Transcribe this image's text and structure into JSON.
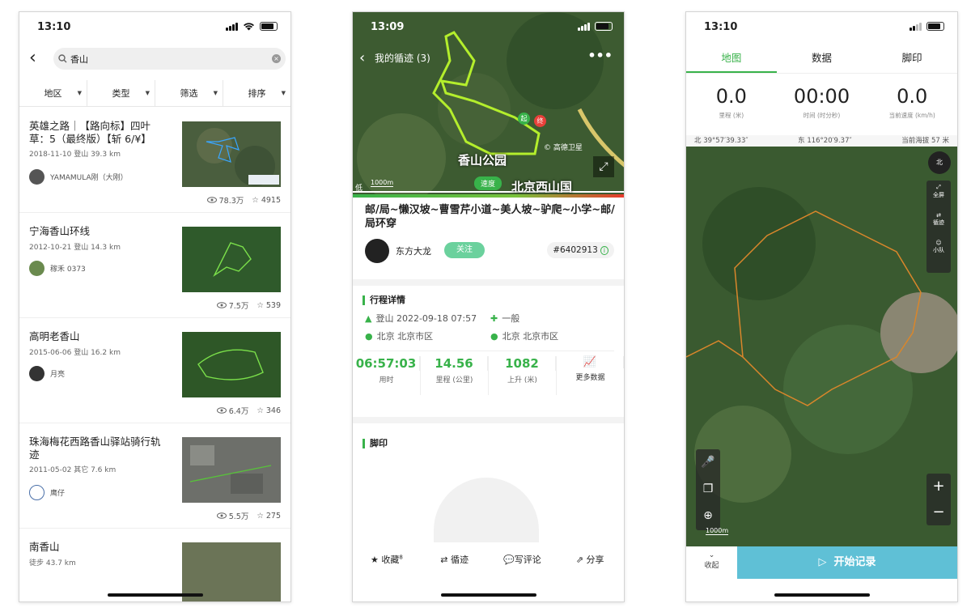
{
  "phone1": {
    "status": {
      "time": "13:10"
    },
    "search": {
      "query": "香山"
    },
    "filters": [
      "地区",
      "类型",
      "筛选",
      "排序"
    ],
    "results": [
      {
        "title": "英雄之路｜【路向标】四叶草：5（最终版）【斩 6/¥】",
        "date": "2018-11-10",
        "type": "登山",
        "dist": "39.3 km",
        "user": "YAMAMULA刚（大刚）",
        "views": "78.3万",
        "likes": "4915"
      },
      {
        "title": "宁海香山环线",
        "date": "2012-10-21",
        "type": "登山",
        "dist": "14.3 km",
        "user": "稼禾 0373",
        "views": "7.5万",
        "likes": "539"
      },
      {
        "title": "高明老香山",
        "date": "2015-06-06",
        "type": "登山",
        "dist": "16.2 km",
        "user": "月亮",
        "views": "6.4万",
        "likes": "346"
      },
      {
        "title": "珠海梅花西路香山驿站骑行轨迹",
        "date": "2011-05-02",
        "type": "其它",
        "dist": "7.6 km",
        "user": "鹰仔",
        "views": "5.5万",
        "likes": "275"
      },
      {
        "title": "南香山",
        "date": "",
        "type": "徒步",
        "dist": "43.7 km",
        "user": "",
        "views": "",
        "likes": ""
      }
    ]
  },
  "phone2": {
    "status": {
      "time": "13:09"
    },
    "map": {
      "nav_title": "我的循迹 (3)",
      "park_label": "香山公园",
      "park2": "北京西山国",
      "sat": "© 高德卫星",
      "scale": "1000m",
      "speed": "速度",
      "tag": "低",
      "start": "起",
      "end": "终"
    },
    "title": "邮/局~懒汉坡~曹雪芹小道~美人坡~驴爬~小学~邮/局环穿",
    "author": "东方大龙",
    "follow": "关注",
    "track_id": "#6402913",
    "details_title": "行程详情",
    "details": {
      "type_time": "登山  2022-09-18 07:57",
      "difficulty": "一般",
      "start_loc": "北京 北京市区",
      "end_loc": "北京 北京市区"
    },
    "stats": [
      {
        "v": "06:57:03",
        "l": "用时"
      },
      {
        "v": "14.56",
        "l": "里程 (公里)"
      },
      {
        "v": "1082",
        "l": "上升 (米)"
      },
      {
        "v": "",
        "l": "更多数据"
      }
    ],
    "footprint_title": "脚印",
    "actions": [
      "收藏",
      "循迹",
      "写评论",
      "分享"
    ],
    "fav_count": "8"
  },
  "phone3": {
    "status": {
      "time": "13:10"
    },
    "tabs": [
      "地图",
      "数据",
      "脚印"
    ],
    "dash": [
      {
        "v": "0.0",
        "l": "里程 (米)"
      },
      {
        "v": "00:00",
        "l": "时间 (时分秒)"
      },
      {
        "v": "0.0",
        "l": "当前速度 (km/h)"
      }
    ],
    "coords": {
      "lat": "北 39°57′39.33″",
      "lon": "东 116°20′9.37″",
      "alt": "当前海拔 57 米"
    },
    "controls": [
      "全屏",
      "循迹",
      "小队"
    ],
    "scale": "1000m",
    "north": "北",
    "collapse": "收起",
    "start": "开始记录"
  }
}
